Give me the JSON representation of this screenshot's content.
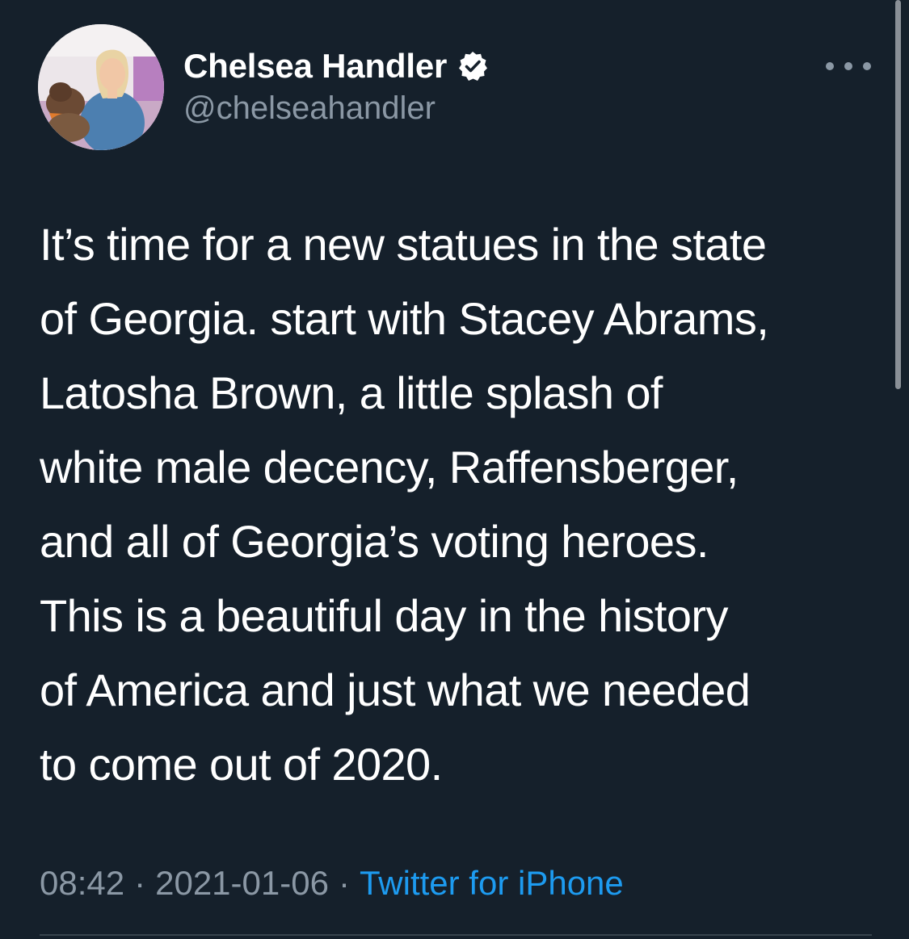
{
  "author": {
    "display_name": "Chelsea Handler",
    "handle": "@chelseahandler",
    "verified": true
  },
  "tweet": {
    "text_lines": [
      "It’s time for a new statues in the state",
      "of Georgia. start with Stacey Abrams,",
      "Latosha Brown, a little splash of",
      "white male decency, Raffensberger,",
      "and all of Georgia’s voting heroes.",
      "This is a beautiful day in the history",
      "of America and just what we needed",
      "to come out of 2020."
    ],
    "time": "08:42",
    "date": "2021-01-06",
    "separator": "·",
    "source": "Twitter for iPhone"
  },
  "icons": {
    "verified": "verified-badge-icon",
    "more": "more-horizontal-icon"
  },
  "colors": {
    "background": "#15202b",
    "text": "#ffffff",
    "secondary_text": "#8b98a5",
    "link": "#1d9bf0",
    "divider": "#38444d"
  }
}
